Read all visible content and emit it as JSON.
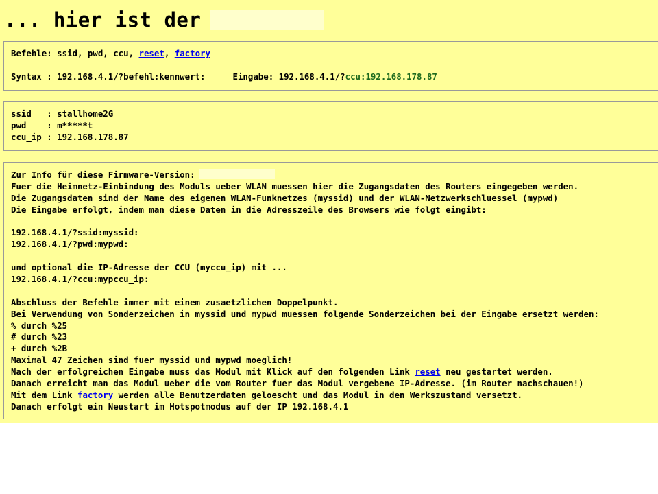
{
  "header": {
    "title": "... hier ist der"
  },
  "commands": {
    "label": "Befehle: ssid, pwd, ccu, ",
    "link_reset": "reset",
    "sep": ", ",
    "link_factory": "factory",
    "syntax": "Syntax : 192.168.4.1/?befehl:kennwert:",
    "eingabe_label": "Eingabe: 192.168.4.1/?",
    "eingabe_value": "ccu:192.168.178.87"
  },
  "status": {
    "ssid": "ssid   : stallhome2G",
    "pwd": "pwd    : m*****t",
    "ccu_ip": "ccu_ip : 192.168.178.87"
  },
  "info": {
    "firmware_label": "Zur Info für diese Firmware-Version:",
    "l1": "Fuer die Heimnetz-Einbindung des Moduls ueber WLAN muessen hier die Zugangsdaten des Routers eingegeben werden.",
    "l2": "Die Zugangsdaten sind der Name des eigenen WLAN-Funknetzes (myssid) und der WLAN-Netzwerkschluessel (mypwd)",
    "l3": "Die Eingabe erfolgt, indem man diese Daten in die Adresszeile des Browsers wie folgt eingibt:",
    "ex1": "192.168.4.1/?ssid:myssid:",
    "ex2": "192.168.4.1/?pwd:mypwd:",
    "opt": "und optional die IP-Adresse der CCU (myccu_ip) mit ...",
    "ex3": "192.168.4.1/?ccu:mypccu_ip:",
    "a1": "Abschluss der Befehle immer mit einem zusaetzlichen Doppelpunkt.",
    "a2": "Bei Verwendung von Sonderzeichen in myssid und mypwd muessen folgende Sonderzeichen bei der Eingabe ersetzt werden:",
    "s1": "% durch %25",
    "s2": "# durch %23",
    "s3": "+ durch %2B",
    "max": "Maximal 47 Zeichen sind fuer myssid und mypwd moeglich!",
    "reset_pre": "Nach der erfolgreichen Eingabe muss das Modul mit Klick auf den folgenden Link ",
    "reset_link": "reset",
    "reset_post": " neu gestartet werden.",
    "router": "Danach erreicht man das Modul ueber die vom Router fuer das Modul vergebene IP-Adresse. (im Router nachschauen!)",
    "factory_pre": "Mit dem Link ",
    "factory_link": "factory",
    "factory_post": " werden alle Benutzerdaten geloescht und das Modul in den Werkszustand versetzt.",
    "hotspot": "Danach erfolgt ein Neustart im Hotspotmodus auf der IP 192.168.4.1"
  },
  "colors": {
    "background": "#ffff99",
    "link": "#0000ee",
    "value_green": "#1e6b1e"
  }
}
